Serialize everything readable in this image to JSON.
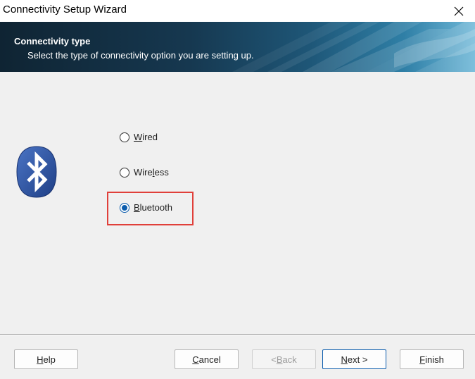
{
  "window": {
    "title": "Connectivity Setup Wizard",
    "close_icon": "close-icon"
  },
  "banner": {
    "title": "Connectivity type",
    "subtitle": "Select the type of connectivity option you are setting up."
  },
  "logo": {
    "icon": "bluetooth-icon",
    "color": "#2a4f9c"
  },
  "options": [
    {
      "pre": "",
      "acc": "W",
      "post": "ired",
      "checked": false
    },
    {
      "pre": "Wire",
      "acc": "l",
      "post": "ess",
      "checked": false
    },
    {
      "pre": "",
      "acc": "B",
      "post": "luetooth",
      "checked": true
    }
  ],
  "highlight_color": "#e0403a",
  "buttons": {
    "help": {
      "pre": "",
      "acc": "H",
      "post": "elp"
    },
    "cancel": {
      "pre": "",
      "acc": "C",
      "post": "ancel"
    },
    "back": {
      "pre": "< ",
      "acc": "B",
      "post": "ack",
      "enabled": false
    },
    "next": {
      "pre": "",
      "acc": "N",
      "post": "ext >"
    },
    "finish": {
      "pre": "",
      "acc": "F",
      "post": "inish"
    }
  }
}
